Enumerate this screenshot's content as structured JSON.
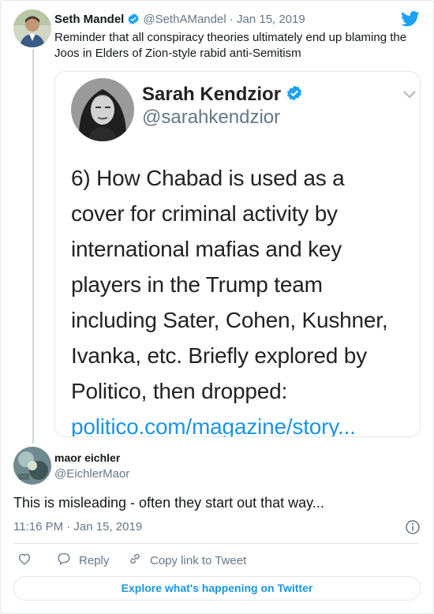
{
  "parent": {
    "name": "Seth Mandel",
    "handle": "@SethAMandel",
    "sep": "·",
    "date": "Jan 15, 2019",
    "text": "Reminder that all conspiracy theories ultimately end up blaming the Joos in Elders of Zion-style rabid anti-Semitism"
  },
  "quote": {
    "name": "Sarah Kendzior",
    "handle": "@sarahkendzior",
    "lines": [
      "6) How Chabad is used as a",
      "cover for criminal activity by",
      "international mafias and key",
      "players in the Trump team",
      "including Sater, Cohen, Kushner,",
      "Ivanka, etc. Briefly explored by",
      "Politico, then dropped:"
    ],
    "link": "politico.com/magazine/story..."
  },
  "reply": {
    "name": "maor eichler",
    "handle": "@EichlerMaor",
    "text": "This is misleading - often they start out that way...",
    "timestamp": "11:16 PM · Jan 15, 2019"
  },
  "actions": {
    "reply_label": "Reply",
    "copy_label": "Copy link to Tweet"
  },
  "explore_label": "Explore what's happening on Twitter",
  "colors": {
    "accent": "#1b95e0",
    "muted": "#657786",
    "border": "#e1e8ed"
  },
  "icons": [
    "twitter-bird-icon",
    "verified-badge-icon",
    "chevron-down-icon",
    "info-icon",
    "heart-icon",
    "reply-icon",
    "link-icon"
  ]
}
